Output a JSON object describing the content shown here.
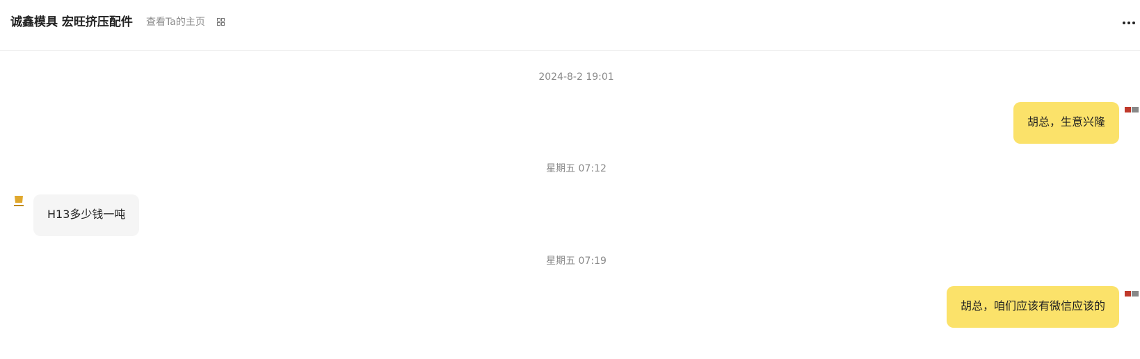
{
  "header": {
    "title": "诚鑫模具 宏旺挤压配件",
    "view_profile": "查看Ta的主页",
    "qr_icon": "qr-code-icon",
    "more_icon": "more-horizontal-icon"
  },
  "messages": [
    {
      "type": "timestamp",
      "text": "2024-8-2 19:01"
    },
    {
      "type": "message",
      "side": "mine",
      "text": "胡总，生意兴隆"
    },
    {
      "type": "timestamp",
      "text": "星期五 07:12"
    },
    {
      "type": "message",
      "side": "theirs",
      "text": "H13多少钱一吨"
    },
    {
      "type": "timestamp",
      "text": "星期五 07:19"
    },
    {
      "type": "message",
      "side": "mine",
      "text": "胡总，咱们应该有微信应该的"
    }
  ],
  "colors": {
    "mine_bubble": "#fbe26a",
    "theirs_bubble": "#f5f5f5",
    "timestamp_text": "#8a8a8a"
  }
}
